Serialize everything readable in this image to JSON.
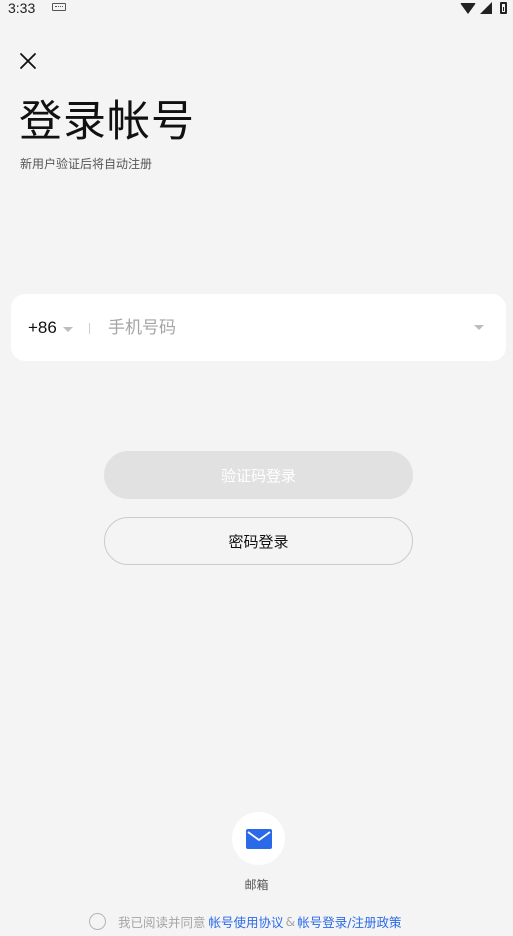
{
  "status_bar": {
    "time": "3:33"
  },
  "header": {
    "title": "登录帐号",
    "subtitle": "新用户验证后将自动注册"
  },
  "phone": {
    "country_code": "+86",
    "placeholder": "手机号码",
    "value": ""
  },
  "buttons": {
    "code_login": "验证码登录",
    "password_login": "密码登录"
  },
  "alt_login": {
    "email_label": "邮箱"
  },
  "agreement": {
    "prefix": "我已阅读并同意",
    "user_agreement": "帐号使用协议",
    "ampersand": "&",
    "privacy_policy": "帐号登录/注册政策"
  },
  "colors": {
    "background": "#f4f4f4",
    "link": "#2a6ae8",
    "disabled_button": "#e1e1e1",
    "email_icon": "#2a6ae8"
  }
}
